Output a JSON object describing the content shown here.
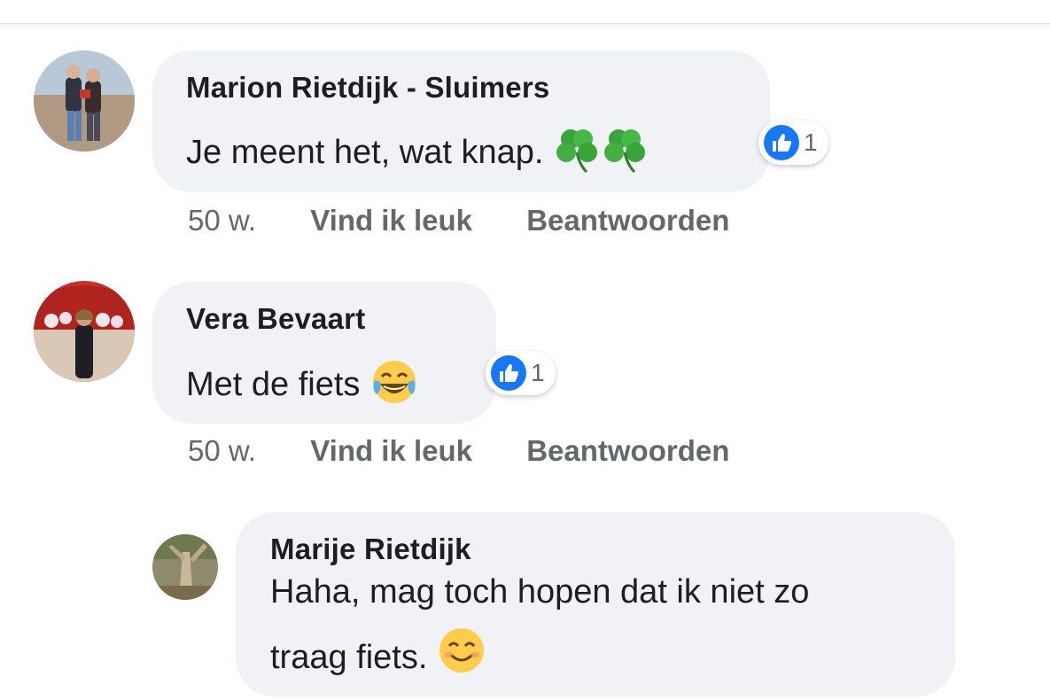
{
  "comments": [
    {
      "author": "Marion Rietdijk - Sluimers",
      "text": "Je meent het, wat knap.",
      "emoji_icons": [
        "four-leaf-clover-icon",
        "four-leaf-clover-icon"
      ],
      "reaction_count": "1",
      "time": "50 w.",
      "like_label": "Vind ik leuk",
      "reply_label": "Beantwoorden"
    },
    {
      "author": "Vera Bevaart",
      "text": "Met de fiets",
      "emoji_icons": [
        "tears-of-joy-icon"
      ],
      "reaction_count": "1",
      "time": "50 w.",
      "like_label": "Vind ik leuk",
      "reply_label": "Beantwoorden"
    }
  ],
  "reply": {
    "author": "Marije Rietdijk",
    "text_line1": "Haha, mag toch hopen dat ik niet zo",
    "text_line2": "traag fiets.",
    "emoji_icons": [
      "smiling-face-icon"
    ]
  },
  "colors": {
    "bubble": "#f0f2f5",
    "like_blue": "#1877f2",
    "meta_gray": "#65676b",
    "text": "#1c1e21"
  }
}
